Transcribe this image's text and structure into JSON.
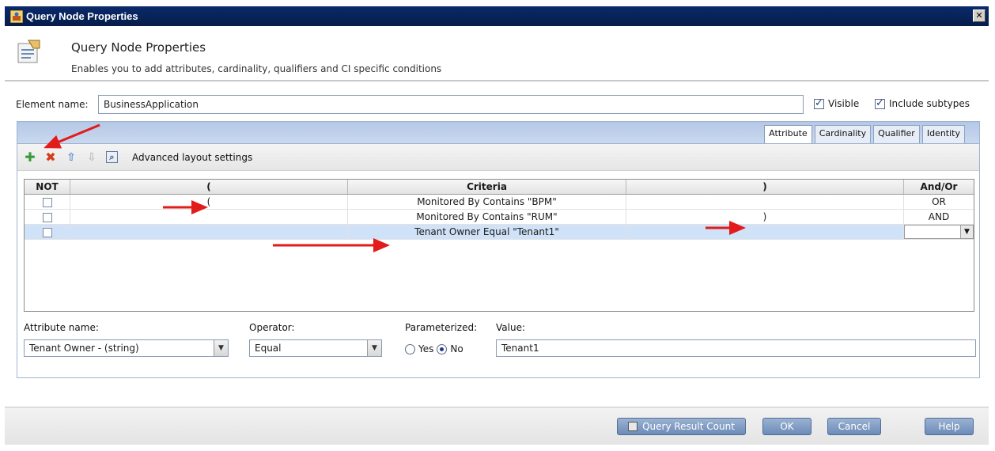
{
  "window": {
    "title": "Query Node Properties",
    "close_glyph": "✕"
  },
  "header": {
    "title": "Query Node Properties",
    "subtitle": "Enables you to add attributes, cardinality, qualifiers and CI specific conditions"
  },
  "element": {
    "label": "Element name:",
    "value": "BusinessApplication",
    "visible_label": "Visible",
    "visible_checked": true,
    "subtypes_label": "Include subtypes",
    "subtypes_checked": true
  },
  "tabs": [
    {
      "label": "Attribute",
      "active": true
    },
    {
      "label": "Cardinality",
      "active": false
    },
    {
      "label": "Qualifier",
      "active": false
    },
    {
      "label": "Identity",
      "active": false
    }
  ],
  "toolbar": {
    "add_icon": "plus-icon",
    "delete_icon": "delete-x-icon",
    "up_icon": "arrow-up-icon",
    "down_icon": "arrow-down-icon",
    "preview_icon": "magnifier-icon",
    "advanced_label": "Advanced layout settings"
  },
  "grid": {
    "headers": [
      "NOT",
      "(",
      "Criteria",
      ")",
      "And/Or"
    ],
    "rows": [
      {
        "not": false,
        "open": "(",
        "criteria": "Monitored By Contains \"BPM\"",
        "close": "",
        "andor": "OR",
        "selected": false
      },
      {
        "not": false,
        "open": "",
        "criteria": "Monitored By Contains \"RUM\"",
        "close": ")",
        "andor": "AND",
        "selected": false
      },
      {
        "not": false,
        "open": "",
        "criteria": "Tenant Owner Equal \"Tenant1\"",
        "close": "",
        "andor": "",
        "selected": true
      }
    ]
  },
  "editor": {
    "attr_label": "Attribute name:",
    "attr_value": "Tenant Owner - (string)",
    "operator_label": "Operator:",
    "operator_value": "Equal",
    "param_label": "Parameterized:",
    "yes_label": "Yes",
    "no_label": "No",
    "param_selected": "No",
    "value_label": "Value:",
    "value": "Tenant1"
  },
  "footer": {
    "query_count_label": "Query Result Count",
    "ok_label": "OK",
    "cancel_label": "Cancel",
    "help_label": "Help"
  },
  "colors": {
    "title_bar": "#0a2a6b",
    "selection": "#cfe2f8",
    "annotation_arrow": "#e21b1b"
  }
}
